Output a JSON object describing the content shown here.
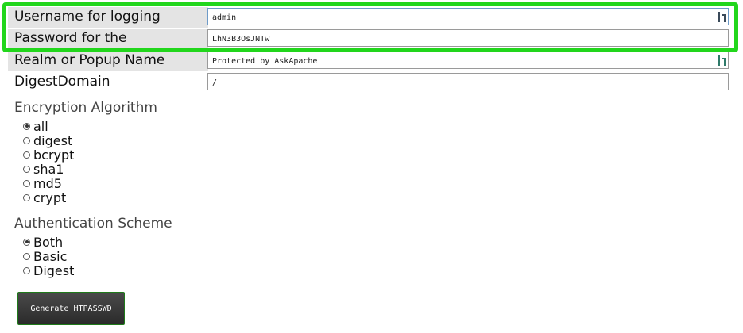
{
  "fields": [
    {
      "label": "Username for logging",
      "value": "admin",
      "manager_icon": true
    },
    {
      "label": "Password for the",
      "value": "LhN3B3OsJNTw",
      "manager_icon": false
    },
    {
      "label": "Realm or Popup Name",
      "value": "Protected by AskApache",
      "manager_icon": true
    },
    {
      "label": "DigestDomain",
      "value": "/",
      "manager_icon": false
    }
  ],
  "encryption": {
    "title": "Encryption Algorithm",
    "options": [
      "all",
      "digest",
      "bcrypt",
      "sha1",
      "md5",
      "crypt"
    ],
    "selected": "all"
  },
  "auth_scheme": {
    "title": "Authentication Scheme",
    "options": [
      "Both",
      "Basic",
      "Digest"
    ],
    "selected": "Both"
  },
  "generate_button": "Generate HTPASSWD",
  "colors": {
    "highlight": "#22d61c",
    "input_focus_border": "#6e9bc8"
  },
  "icons": {
    "password_manager": "password-manager-icon"
  }
}
